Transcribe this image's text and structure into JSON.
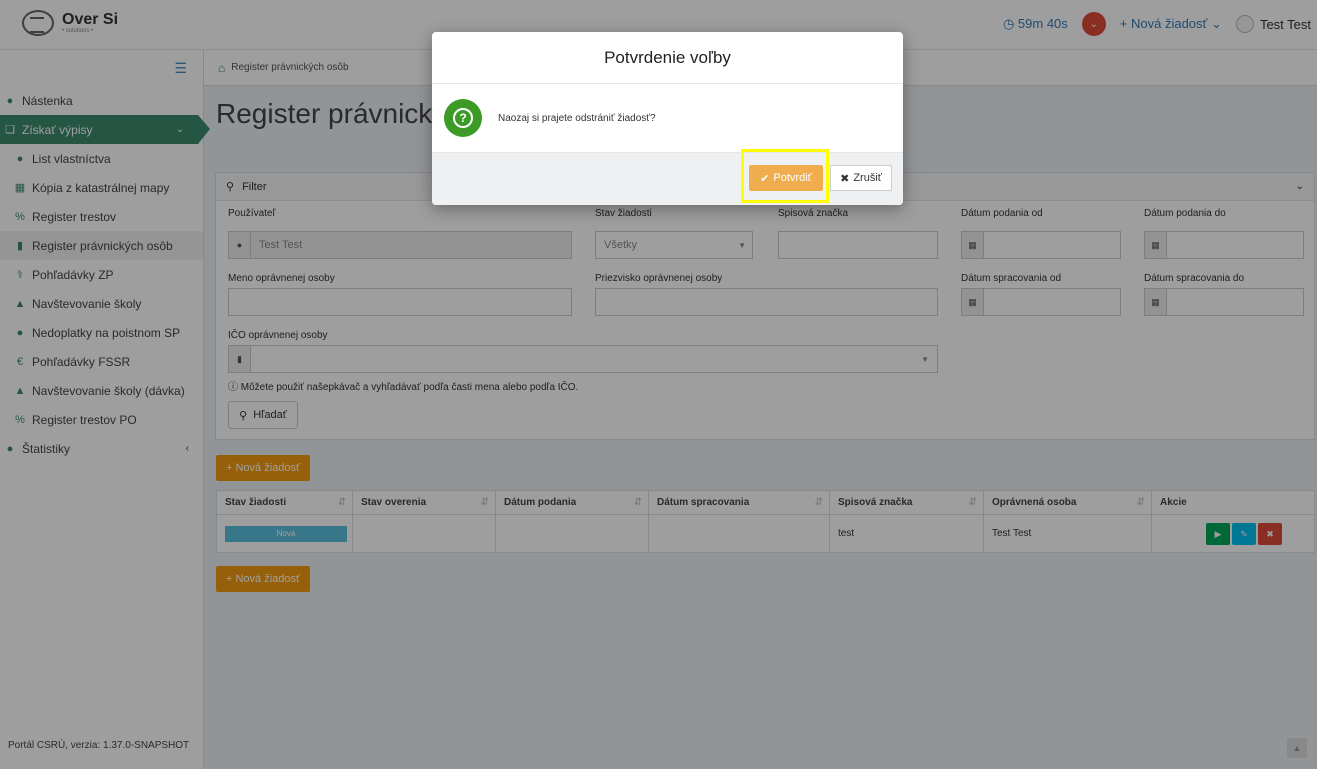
{
  "header": {
    "logo_text": "Over Si",
    "logo_sub": "• solutions •",
    "timer": "59m 40s",
    "new_request": "+ Nová žiadosť",
    "user": "Test Test"
  },
  "breadcrumb": "Register právnických osôb",
  "page_title": "Register právnických osôb",
  "sidebar": {
    "items": [
      {
        "label": "Nástenka"
      },
      {
        "label": "Získať výpisy"
      },
      {
        "label": "List vlastníctva"
      },
      {
        "label": "Kópia z katastrálnej mapy"
      },
      {
        "label": "Register trestov"
      },
      {
        "label": "Register právnických osôb"
      },
      {
        "label": "Pohľadávky ZP"
      },
      {
        "label": "Navštevovanie školy"
      },
      {
        "label": "Nedoplatky na poistnom SP"
      },
      {
        "label": "Pohľadávky FSSR"
      },
      {
        "label": "Navštevovanie školy (dávka)"
      },
      {
        "label": "Register trestov PO"
      },
      {
        "label": "Štatistiky"
      }
    ],
    "footer": "Portál CSRÚ, verzia: 1.37.0-SNAPSHOT"
  },
  "filter": {
    "title": "Filter",
    "user_label": "Používateľ",
    "user_value": "Test Test",
    "status_label": "Stav žiadosti",
    "status_value": "Všetky",
    "file_label": "Spisová značka",
    "date_from_label": "Dátum podania od",
    "date_to_label": "Dátum podania do",
    "name_label": "Meno oprávnenej osoby",
    "surname_label": "Priezvisko oprávnenej osoby",
    "proc_from_label": "Dátum spracovania od",
    "proc_to_label": "Dátum spracovania do",
    "ico_label": "IČO oprávnenej osoby",
    "info": "Môžete použiť našepkávač a vyhľadávať podľa časti mena alebo podľa IČO.",
    "search_button": "Hľadať"
  },
  "new_request_button": "+ Nová žiadosť",
  "table": {
    "headers": [
      "Stav žiadosti",
      "Stav overenia",
      "Dátum podania",
      "Dátum spracovania",
      "Spisová značka",
      "Oprávnená osoba",
      "Akcie"
    ],
    "row": {
      "status": "Nová",
      "verification": "",
      "submitted": "",
      "processed": "",
      "file_no": "test",
      "person": "Test Test"
    }
  },
  "modal": {
    "title": "Potvrdenie voľby",
    "message": "Naozaj si prajete odstrániť žiadosť?",
    "confirm": "Potvrdiť",
    "cancel": "Zrušiť"
  },
  "colors": {
    "accent": "#3d8b6e",
    "orange": "#f39c12",
    "danger": "#dd4b39",
    "info": "#5bc0de"
  }
}
